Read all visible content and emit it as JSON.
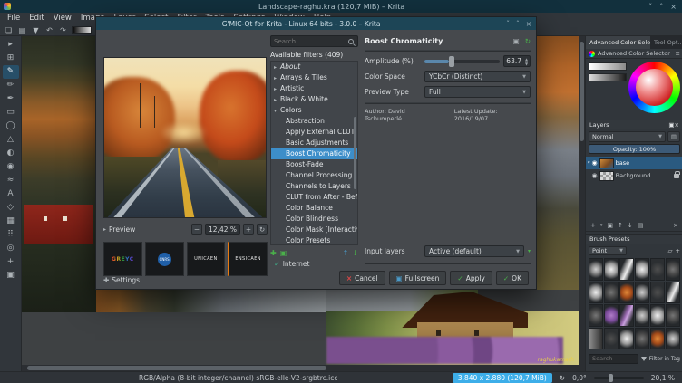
{
  "app": {
    "title": "Landscape-raghu.kra (120,7 MiB) – Krita",
    "menu": [
      "File",
      "Edit",
      "View",
      "Image",
      "Layer",
      "Select",
      "Filter",
      "Tools",
      "Settings",
      "Window",
      "Help"
    ]
  },
  "canvas": {
    "signature": "raghukamath"
  },
  "dialog": {
    "title": "G'MIC-Qt for Krita - Linux 64 bits - 3.0.0 – Krita",
    "search_placeholder": "Search",
    "filters_header": "Available filters (409)",
    "categories": [
      "About",
      "Arrays & Tiles",
      "Artistic",
      "Black & White",
      "Colors"
    ],
    "filters": [
      "Abstraction",
      "Apply External CLUT",
      "Basic Adjustments",
      "Boost Chromaticity",
      "Boost-Fade",
      "Channel Processing",
      "Channels to Layers",
      "CLUT from After - Before",
      "Color Balance",
      "Color Blindness",
      "Color Mask [Interactive]",
      "Color Presets"
    ],
    "internet_label": "Internet",
    "preview_label": "Preview",
    "zoom_value": "12,42 %",
    "logos": [
      "GREYC",
      "CNRS",
      "UNICAEN",
      "ENSICAEN"
    ],
    "settings_label": "Settings...",
    "panel": {
      "title": "Boost Chromaticity",
      "amplitude_label": "Amplitude (%)",
      "amplitude_value": "63.7",
      "color_space_label": "Color Space",
      "color_space_value": "YCbCr (Distinct)",
      "preview_type_label": "Preview Type",
      "preview_type_value": "Full",
      "author_line": "Author: David Tschumperlé.",
      "update_line": "Latest Update: 2016/19/07.",
      "input_layers_label": "Input layers",
      "input_layers_value": "Active (default)"
    },
    "buttons": {
      "cancel": "Cancel",
      "fullscreen": "Fullscreen",
      "apply": "Apply",
      "ok": "OK"
    }
  },
  "docks": {
    "tabs": [
      "Advanced Color Sele...",
      "Tool Opt..."
    ],
    "color_selector_title": "Advanced Color Selector",
    "layers": {
      "title": "Layers",
      "blend_mode": "Normal",
      "opacity_label": "Opacity: 100%",
      "layer1_name": "base",
      "layer2_name": "Background"
    },
    "brushes": {
      "title": "Brush Presets",
      "mode": "Point",
      "search_placeholder": "Search",
      "filter_label": "Filter in Tag"
    }
  },
  "status": {
    "profile": "RGB/Alpha (8-bit integer/channel)  sRGB-elle-V2-srgbtrc.icc",
    "dims": "3.840 x 2.880 (120,7 MiB)",
    "angle": "0,0°",
    "zoom": "20,1 %"
  }
}
